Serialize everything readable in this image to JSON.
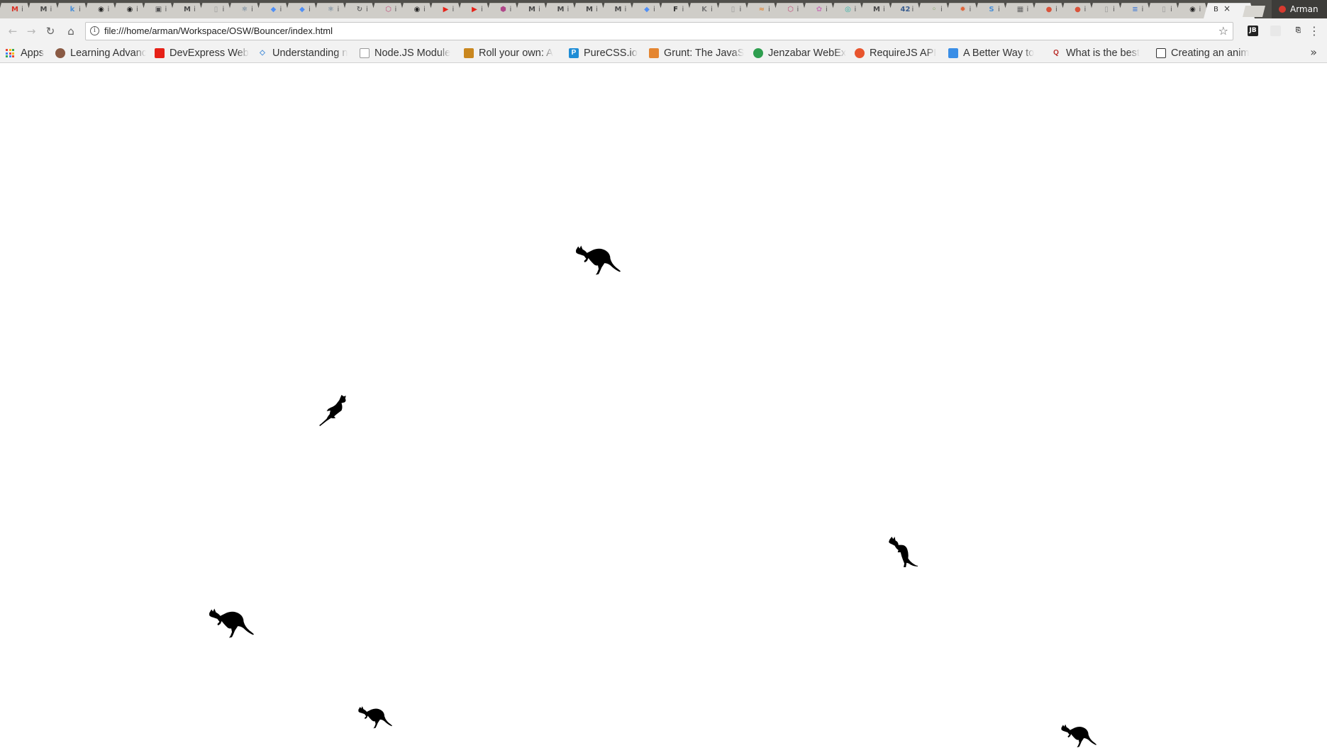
{
  "browser": {
    "active_tab_label": "B",
    "close_label": "×",
    "profile_name": "Arman",
    "new_tab_label": "",
    "tabs": [
      {
        "glyph": "M",
        "color": "#d93025",
        "icon": "gmail-icon"
      },
      {
        "glyph": "M",
        "color": "#4a4a4a",
        "icon": "medium-icon"
      },
      {
        "glyph": "k",
        "color": "#4a90d9",
        "icon": "k-icon"
      },
      {
        "glyph": "◉",
        "color": "#222222",
        "icon": "github-icon"
      },
      {
        "glyph": "◉",
        "color": "#222222",
        "icon": "github-icon"
      },
      {
        "glyph": "▣",
        "color": "#555555",
        "icon": "page-icon"
      },
      {
        "glyph": "M",
        "color": "#4a4a4a",
        "icon": "medium-icon"
      },
      {
        "glyph": "▯",
        "color": "#999999",
        "icon": "document-icon"
      },
      {
        "glyph": "⚛",
        "color": "#4a6b8a",
        "icon": "react-icon"
      },
      {
        "glyph": "◆",
        "color": "#4f8ff7",
        "icon": "app-icon"
      },
      {
        "glyph": "◆",
        "color": "#4f8ff7",
        "icon": "app-icon"
      },
      {
        "glyph": "⚛",
        "color": "#4a6b8a",
        "icon": "react-icon"
      },
      {
        "glyph": "↻",
        "color": "#666666",
        "icon": "reload-icon"
      },
      {
        "glyph": "⬡",
        "color": "#c24b7a",
        "icon": "hex-icon"
      },
      {
        "glyph": "◉",
        "color": "#222222",
        "icon": "github-icon"
      },
      {
        "glyph": "▶",
        "color": "#e62117",
        "icon": "youtube-icon"
      },
      {
        "glyph": "▶",
        "color": "#e62117",
        "icon": "youtube-icon"
      },
      {
        "glyph": "⬢",
        "color": "#b0478a",
        "icon": "shield-icon"
      },
      {
        "glyph": "M",
        "color": "#4a4a4a",
        "icon": "medium-icon"
      },
      {
        "glyph": "M",
        "color": "#4a4a4a",
        "icon": "medium-icon"
      },
      {
        "glyph": "M",
        "color": "#4a4a4a",
        "icon": "medium-icon"
      },
      {
        "glyph": "M",
        "color": "#4a4a4a",
        "icon": "medium-icon"
      },
      {
        "glyph": "◆",
        "color": "#4f8ff7",
        "icon": "app-icon"
      },
      {
        "glyph": "F",
        "color": "#333333",
        "icon": "f-icon"
      },
      {
        "glyph": "K",
        "color": "#777777",
        "icon": "k-logo-icon"
      },
      {
        "glyph": "▯",
        "color": "#999999",
        "icon": "document-icon"
      },
      {
        "glyph": "≈",
        "color": "#e08a3c",
        "icon": "wave-icon"
      },
      {
        "glyph": "⬡",
        "color": "#c24b7a",
        "icon": "hex-icon"
      },
      {
        "glyph": "✿",
        "color": "#c77ab8",
        "icon": "flower-icon"
      },
      {
        "glyph": "◎",
        "color": "#2bb3a8",
        "icon": "circle-icon"
      },
      {
        "glyph": "M",
        "color": "#4a4a4a",
        "icon": "medium-icon"
      },
      {
        "glyph": "42",
        "color": "#3a5d8f",
        "icon": "42-icon"
      },
      {
        "glyph": "◦",
        "color": "#7aa35e",
        "icon": "leaf-icon"
      },
      {
        "glyph": "✹",
        "color": "#e0653a",
        "icon": "sun-icon"
      },
      {
        "glyph": "S",
        "color": "#4a90d9",
        "icon": "s-icon"
      },
      {
        "glyph": "▦",
        "color": "#666666",
        "icon": "grid-icon"
      },
      {
        "glyph": "●",
        "color": "#d9533a",
        "icon": "red-dot-icon"
      },
      {
        "glyph": "●",
        "color": "#d9533a",
        "icon": "red-dot-icon"
      },
      {
        "glyph": "▯",
        "color": "#999999",
        "icon": "document-icon"
      },
      {
        "glyph": "≡",
        "color": "#4a7fd4",
        "icon": "docs-icon"
      },
      {
        "glyph": "▯",
        "color": "#999999",
        "icon": "document-icon"
      },
      {
        "glyph": "◉",
        "color": "#222222",
        "icon": "github-icon"
      }
    ],
    "tab_cut_char": "i",
    "url": "file:///home/arman/Workspace/OSW/Bouncer/index.html",
    "info_icon": "i",
    "star_icon": "☆",
    "menu_icon": "⋮",
    "back_icon": "←",
    "forward_icon": "→",
    "reload_icon": "↻",
    "home_icon": "⌂",
    "extensions": [
      {
        "glyph": "JB",
        "color": "#222222",
        "bg": "#222222",
        "fg": "#ffffff"
      },
      {
        "glyph": "",
        "color": "#dddddd",
        "bg": "#e8e8e8",
        "fg": "#999999"
      },
      {
        "glyph": "⎘",
        "color": "#333333",
        "bg": "#f2f2f2",
        "fg": "#333333"
      }
    ],
    "overflow_icon": "»"
  },
  "bookmarks": [
    {
      "label": "Apps",
      "icon": "apps-icon",
      "color": "#4a90d9"
    },
    {
      "label": "Learning Advanc",
      "icon": "avatar-icon",
      "color": "#8a5a44"
    },
    {
      "label": "DevExpress Web",
      "icon": "youtube-icon",
      "color": "#e62117"
    },
    {
      "label": "Understanding n",
      "icon": "diamond-icon",
      "color": "#4a90d9"
    },
    {
      "label": "Node.JS Module",
      "icon": "document-icon",
      "color": "#999999"
    },
    {
      "label": "Roll your own: A",
      "icon": "badge-icon",
      "color": "#c9871f"
    },
    {
      "label": "PureCSS.io",
      "icon": "p-icon",
      "color": "#1f8dd6"
    },
    {
      "label": "Grunt: The JavaS",
      "icon": "grunt-icon",
      "color": "#e48632"
    },
    {
      "label": "Jenzabar WebEx",
      "icon": "globe-icon",
      "color": "#2e9e4f"
    },
    {
      "label": "RequireJS API",
      "icon": "requirejs-icon",
      "color": "#e8552e"
    },
    {
      "label": "A Better Way to",
      "icon": "smile-icon",
      "color": "#3a8ee6"
    },
    {
      "label": "What is the best",
      "icon": "quora-icon",
      "color": "#b92b27"
    },
    {
      "label": "Creating an anim",
      "icon": "window-icon",
      "color": "#333333"
    }
  ],
  "kangaroos": [
    {
      "id": "kangaroo-1",
      "variant": "leap"
    },
    {
      "id": "kangaroo-2",
      "variant": "upright"
    },
    {
      "id": "kangaroo-3",
      "variant": "stand"
    },
    {
      "id": "kangaroo-4",
      "variant": "leap"
    },
    {
      "id": "kangaroo-5",
      "variant": "leap"
    },
    {
      "id": "kangaroo-6",
      "variant": "leap"
    }
  ]
}
